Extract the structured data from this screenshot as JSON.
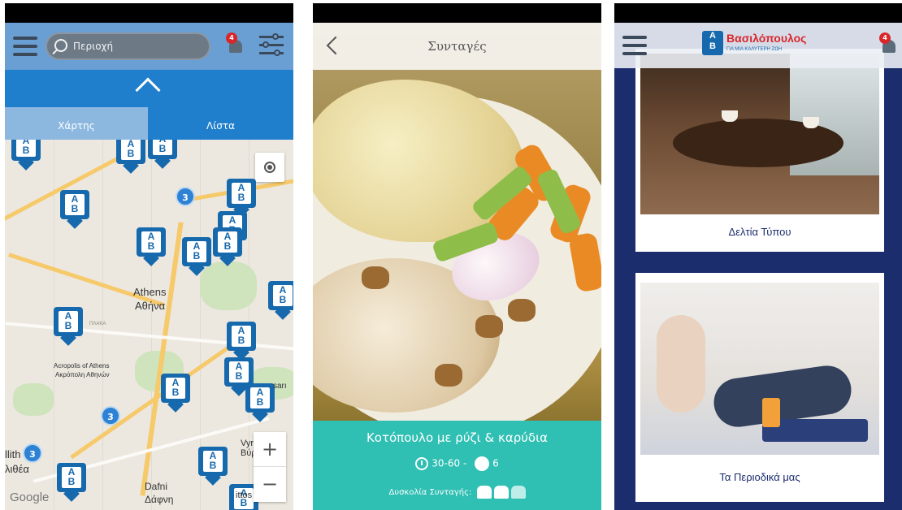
{
  "map_screen": {
    "search": {
      "placeholder": "Περιοχή"
    },
    "notifications": {
      "badge": "4"
    },
    "tabs": [
      {
        "label": "Χάρτης",
        "active": true
      },
      {
        "label": "Λίστα",
        "active": false
      }
    ],
    "clusters": [
      "3",
      "3",
      "3"
    ],
    "labels": {
      "athens_en": "Athens",
      "athens_gr": "Αθήνα",
      "acropolis_en": "Acropolis of Athens",
      "acropolis_gr": "Ακρόπολη Αθηνών",
      "vyronas": "Βύρ",
      "vyronas_en": "Vyr",
      "dafni_en": "Dafni",
      "dafni_gr": "Δάφνη",
      "kallithea_en": "llith",
      "kallithea_gr": "λιθέα",
      "plaka": "ΠΛΑΚΑ",
      "ilissia": "Ilissia",
      "rtos": "ittos",
      "kaisar": "sarı"
    },
    "zoom": {
      "in": "+",
      "out": "−"
    },
    "attribution": "Google",
    "colors": {
      "header": "#6a9fd3",
      "bar": "#1f7fcc",
      "pin": "#1769ad"
    }
  },
  "recipe_screen": {
    "title": "Συνταγές",
    "recipe_name": "Κοτόπουλο με ρύζι & καρύδια",
    "time": "30-60",
    "separator": "-",
    "servings": "6",
    "difficulty_label": "Δυσκολία Συνταγής:",
    "difficulty_level": 2,
    "difficulty_max": 3,
    "colors": {
      "footer": "#2fbfb3"
    }
  },
  "news_screen": {
    "brand_name": "Βασιλόπουλος",
    "brand_tagline": "ΓΙΑ ΜΙΑ ΚΑΛΥΤΕΡΗ ΖΩΗ",
    "notifications": {
      "badge": "4"
    },
    "cards": [
      {
        "caption": "Δελτία Τύπου"
      },
      {
        "caption": "Τα Περιοδικά μας"
      }
    ],
    "colors": {
      "background": "#1c2d6e",
      "brand_red": "#d9262b"
    }
  }
}
